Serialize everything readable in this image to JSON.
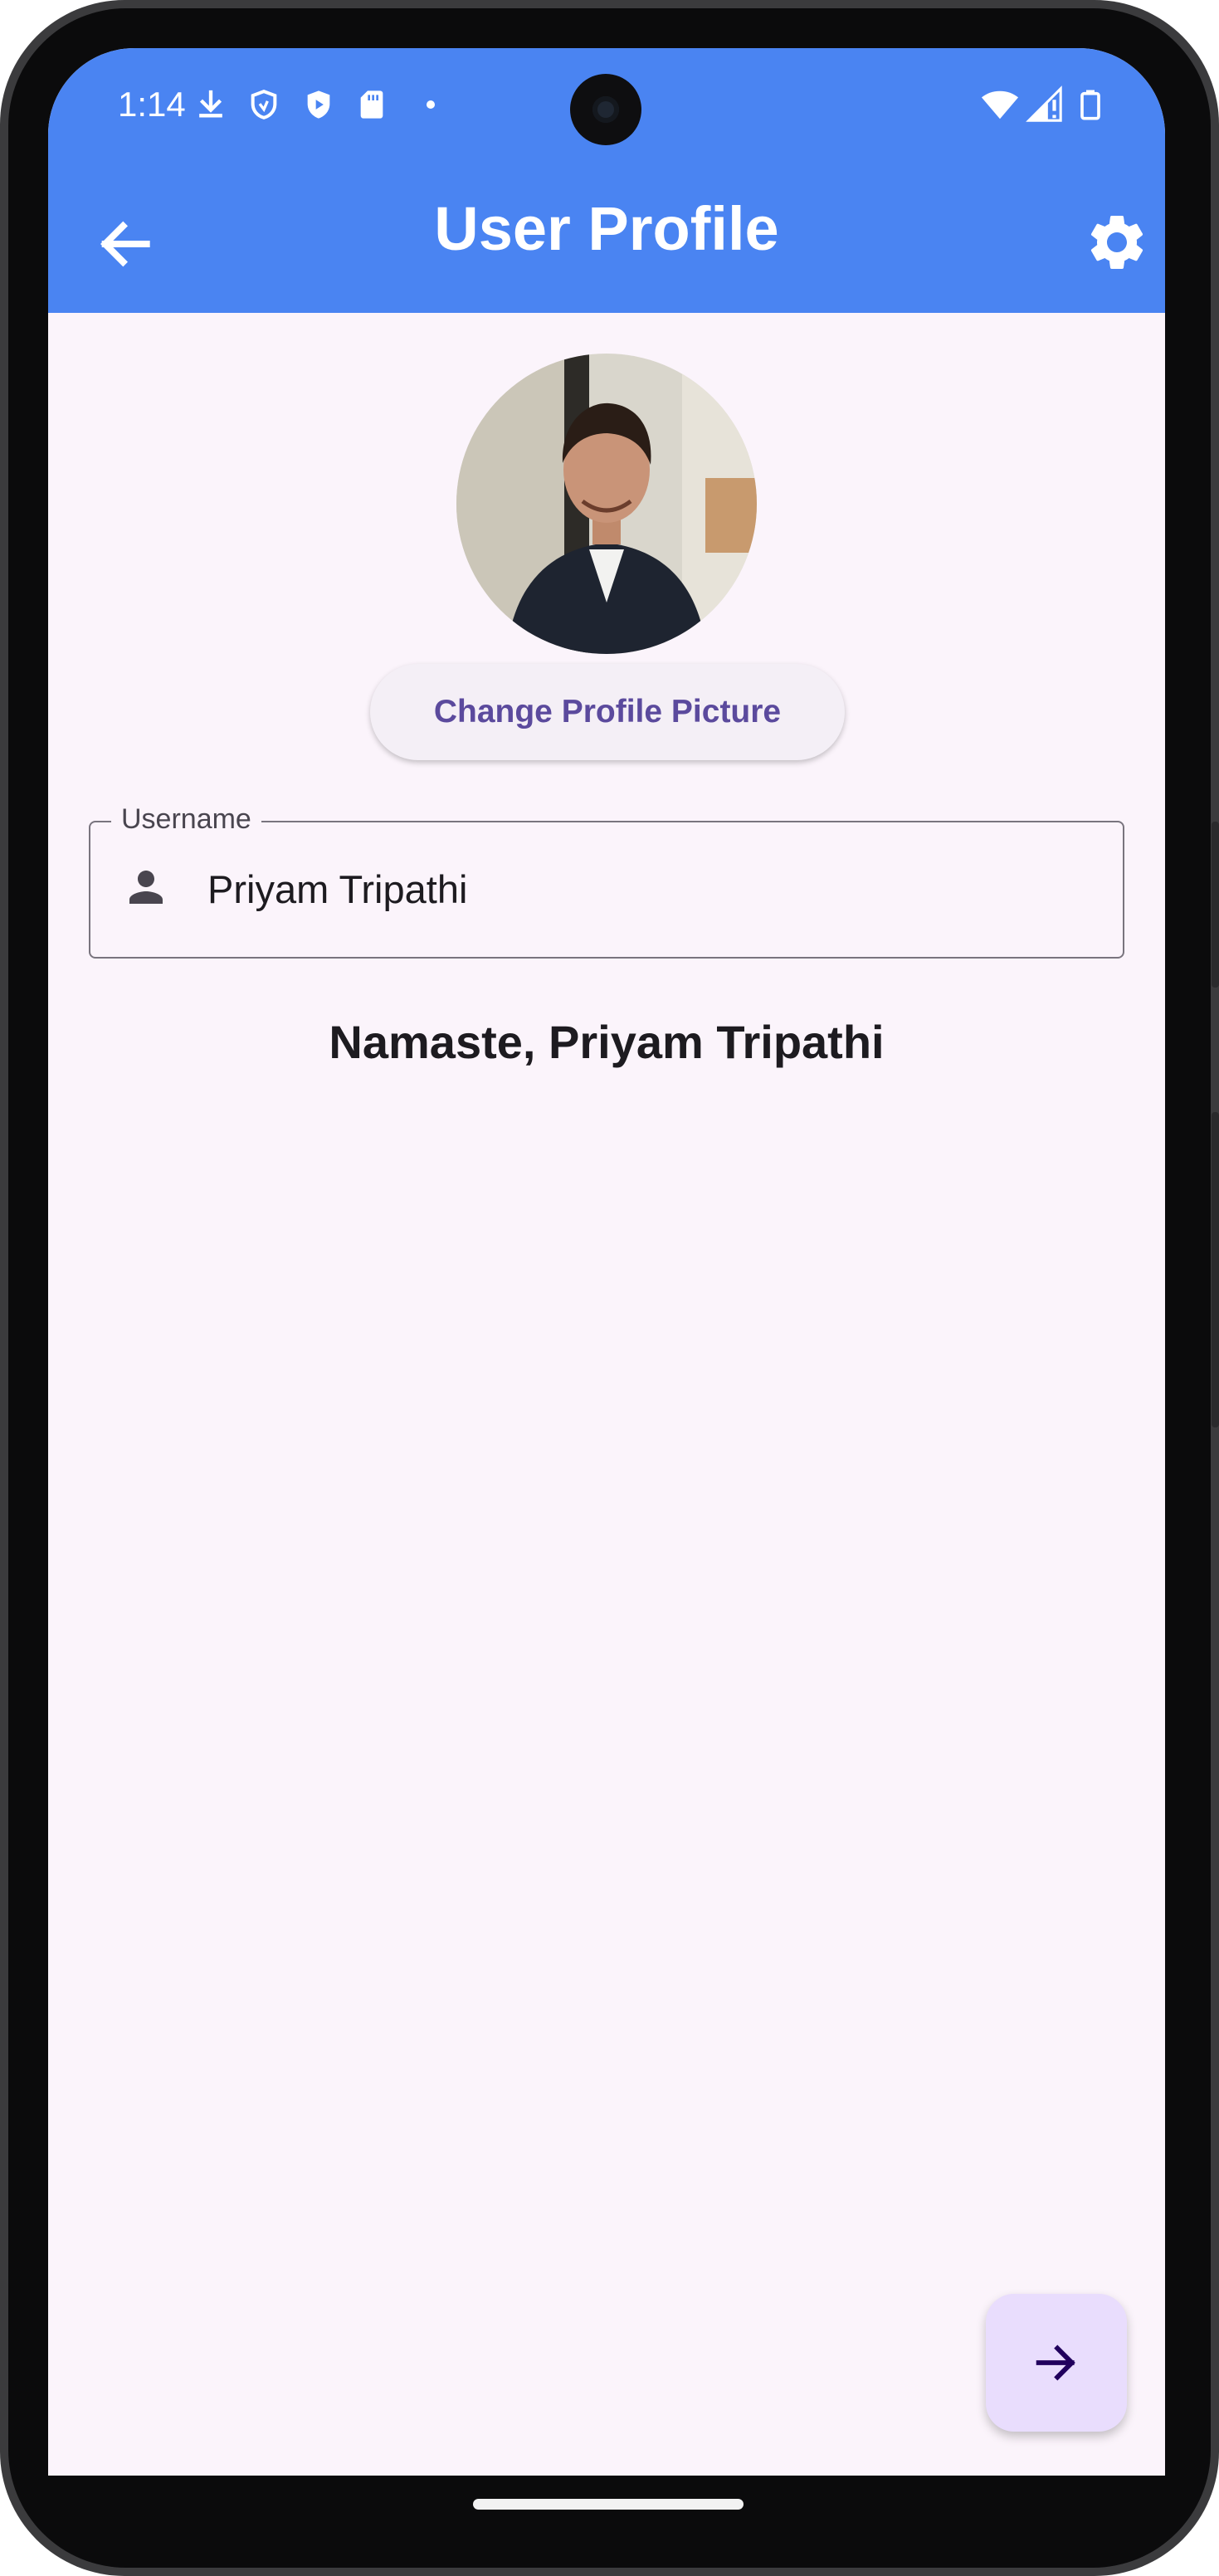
{
  "status_bar": {
    "time": "1:14"
  },
  "app_bar": {
    "title": "User Profile",
    "background": "#4a84f2"
  },
  "profile": {
    "change_picture_label": "Change Profile Picture",
    "username_label": "Username",
    "username_value": "Priyam Tripathi",
    "greeting": "Namaste, Priyam Tripathi"
  },
  "icons": {
    "back": "arrow-left-icon",
    "settings": "gear-icon",
    "username": "person-icon",
    "fab": "arrow-right-icon"
  },
  "colors": {
    "accent": "#5b4a9d",
    "fab_background": "#e9ddfd",
    "screen_background": "#fbf4fb"
  }
}
